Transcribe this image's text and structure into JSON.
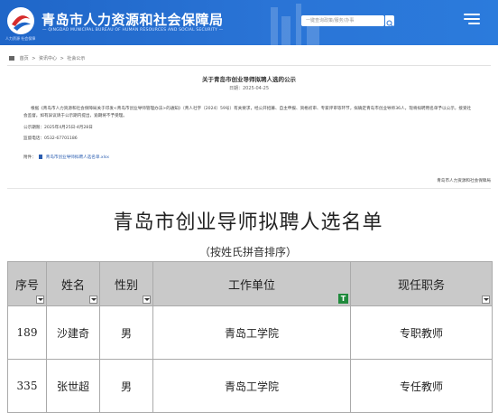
{
  "header": {
    "logo_text": "人力资源 社会保障",
    "site_title": "青岛市人力资源和社会保障局",
    "site_subtitle": "— QINGDAO MUNICIPAL BUREAU OF HUMAN RESOURCES AND SOCIAL SECURITY —",
    "search_placeholder": "一键查询政策/服务/办事",
    "colors": {
      "header_bg": "#1f66c8",
      "link": "#2a5db0",
      "table_header_bg": "#c9c9c9",
      "filter_active": "#1f8a3c"
    }
  },
  "breadcrumb": {
    "items": [
      "首页",
      "资讯中心",
      "社会公示"
    ],
    "separator": ">"
  },
  "article": {
    "title": "关于青岛市创业导师拟聘人选的公示",
    "date": "日期：2025-04-25",
    "body": "根据《青岛市人力资源和社会保障局关于印发<青岛市创业导师管理办法>的通知》（青人社字〔2024〕59号）有关要求，经公开招募、自主申报、资格初审、专家评审等环节，拟确定青岛市创业导师36人，现将拟聘用名单予以公示，接受社会监督。如有异议请于公示期内提出，逾期将不予受理。",
    "period": "公示期限：2025年4月25日-4月28日",
    "phone": "监督电话：0532-67701186",
    "attachment_label": "附件：",
    "attachment_name": "青岛市创业导师拟聘人选名单.xlsx",
    "signature": "青岛市人力资源和社会保障局"
  },
  "document": {
    "title": "青岛市创业导师拟聘人选名单",
    "subtitle": "（按姓氏拼音排序）",
    "columns": [
      "序号",
      "姓名",
      "性别",
      "工作单位",
      "现任职务"
    ],
    "rows": [
      [
        "189",
        "沙建奇",
        "男",
        "青岛工学院",
        "专职教师"
      ],
      [
        "335",
        "张世超",
        "男",
        "青岛工学院",
        "专任教师"
      ]
    ]
  }
}
